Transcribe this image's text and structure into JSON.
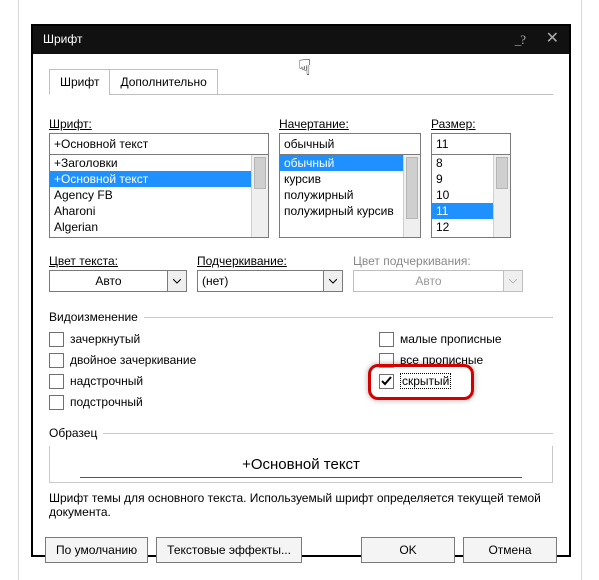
{
  "window": {
    "title": "Шрифт",
    "help": "_?",
    "close": "✕"
  },
  "tabs": {
    "font": "Шрифт",
    "advanced": "Дополнительно"
  },
  "labels": {
    "font": "Шрифт:",
    "style": "Начертание:",
    "size": "Размер:",
    "color": "Цвет текста:",
    "underline": "Подчеркивание:",
    "underline_color": "Цвет подчеркивания:",
    "effects": "Видоизменение",
    "sample": "Образец"
  },
  "font": {
    "value": "+Основной текст",
    "items": {
      "0": "+Заголовки",
      "1": "+Основной текст",
      "2": "Agency FB",
      "3": "Aharoni",
      "4": "Algerian"
    }
  },
  "style": {
    "value": "обычный",
    "items": {
      "0": "обычный",
      "1": "курсив",
      "2": "полужирный",
      "3": "полужирный курсив"
    }
  },
  "size": {
    "value": "11",
    "items": {
      "0": "8",
      "1": "9",
      "2": "10",
      "3": "11",
      "4": "12"
    }
  },
  "color": {
    "value": "Авто"
  },
  "underline": {
    "value": "(нет)"
  },
  "underline_color": {
    "value": "Авто"
  },
  "effects": {
    "strike": "зачеркнутый",
    "dstrike": "двойное зачеркивание",
    "superscript": "надстрочный",
    "subscript": "подстрочный",
    "smallcaps": "малые прописные",
    "allcaps": "все прописные",
    "hidden": "скрытый"
  },
  "sample_text": "+Основной текст",
  "description": "Шрифт темы для основного текста. Используемый шрифт определяется текущей темой документа.",
  "buttons": {
    "default": "По умолчанию",
    "text_effects": "Текстовые эффекты...",
    "ok": "OK",
    "cancel": "Отмена"
  }
}
